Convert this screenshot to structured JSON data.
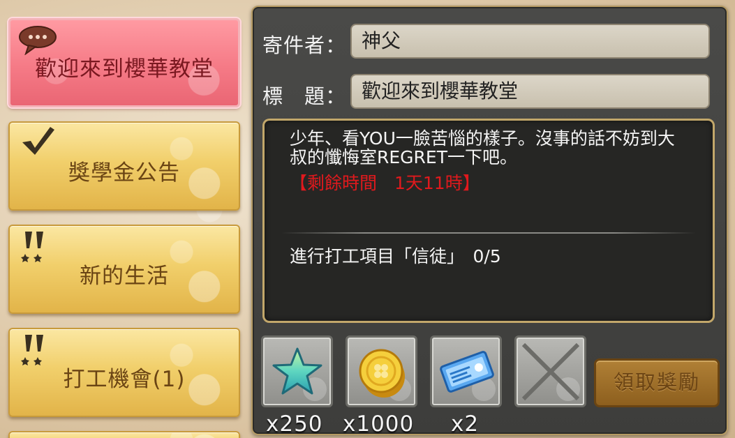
{
  "tabs": [
    {
      "label": "歡迎來到櫻華教堂",
      "icon": "speech-bubble-icon",
      "active": true
    },
    {
      "label": "獎學金公告",
      "icon": "checkmark-icon",
      "active": false
    },
    {
      "label": "新的生活",
      "icon": "double-exclamation-icon",
      "active": false
    },
    {
      "label": "打工機會(1)",
      "icon": "double-exclamation-icon",
      "active": false
    }
  ],
  "mail": {
    "sender_label": "寄件者：",
    "sender": "神父",
    "subject_label": "標　題：",
    "subject": "歡迎來到櫻華教堂",
    "body": "少年、看YOU一臉苦惱的樣子。沒事的話不妨到大叔的懺悔室REGRET一下吧。",
    "remaining": "【剩餘時間　1天11時】",
    "task": "進行打工項目「信徒」　0/5"
  },
  "rewards": [
    {
      "icon": "star-icon",
      "count": "x250"
    },
    {
      "icon": "gold-coin-icon",
      "count": "x1000"
    },
    {
      "icon": "ticket-icon",
      "count": "x2"
    },
    {
      "icon": "empty-slot-icon",
      "count": ""
    }
  ],
  "claim_button": "領取獎勵",
  "colors": {
    "active_tab": "#f57a86",
    "tab": "#f1cf6b",
    "remaining_text": "#e0191d",
    "panel": "#3d3d3b"
  }
}
